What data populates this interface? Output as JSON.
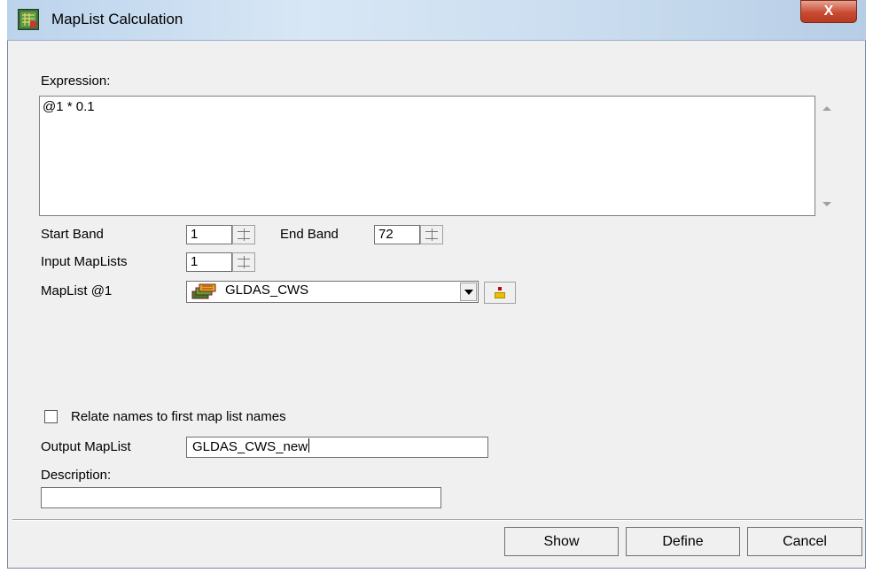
{
  "window": {
    "title": "MapList Calculation",
    "close_symbol": "X",
    "icon": "ilwis-app-icon"
  },
  "expression": {
    "label": "Expression:",
    "value": "@1 * 0.1"
  },
  "bands": {
    "start_label": "Start Band",
    "start_value": "1",
    "end_label": "End Band",
    "end_value": "72"
  },
  "input_maplists": {
    "label": "Input MapLists",
    "value": "1"
  },
  "maplist1": {
    "label": "MapList @1",
    "selected": "GLDAS_CWS",
    "icon": "maplist-icon"
  },
  "relate_names": {
    "label": "Relate names to first map list names",
    "checked": false
  },
  "output_maplist": {
    "label": "Output MapList",
    "value": "GLDAS_CWS_new"
  },
  "description": {
    "label": "Description:",
    "value": ""
  },
  "buttons": {
    "show": "Show",
    "define": "Define",
    "cancel": "Cancel"
  }
}
